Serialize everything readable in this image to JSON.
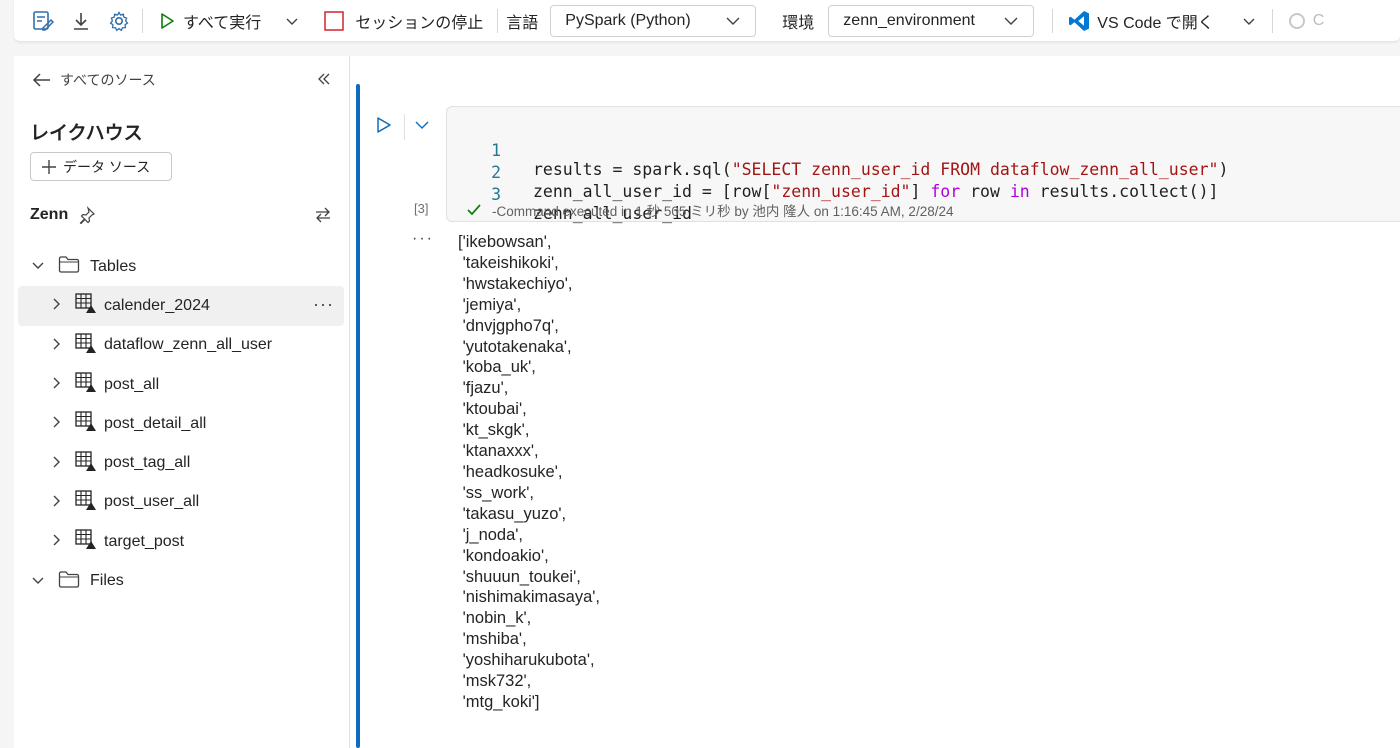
{
  "toolbar": {
    "run_all": "すべて実行",
    "stop_session": "セッションの停止",
    "language_label": "言語",
    "language_value": "PySpark (Python)",
    "env_label": "環境",
    "env_value": "zenn_environment",
    "open_vscode": "VS Code で開く",
    "trailing_text": "C"
  },
  "sidebar": {
    "back_label": "すべてのソース",
    "lakehouse_title": "レイクハウス",
    "add_source": "データ ソース",
    "lakehouse_name": "Zenn",
    "tables_folder": "Tables",
    "files_folder": "Files",
    "tables": [
      "calender_2024",
      "dataflow_zenn_all_user",
      "post_all",
      "post_detail_all",
      "post_tag_all",
      "post_user_all",
      "target_post"
    ]
  },
  "cell": {
    "line_numbers": [
      "1",
      "2",
      "3"
    ],
    "code": {
      "l1_a": "results = spark.sql(",
      "l1_str": "\"SELECT zenn_user_id FROM dataflow_zenn_all_user\"",
      "l1_b": ")",
      "l2_a": "zenn_all_user_id = [row[",
      "l2_str": "\"zenn_user_id\"",
      "l2_b": "] ",
      "l2_kw1": "for",
      "l2_c": " row ",
      "l2_kw2": "in",
      "l2_d": " results.collect()]",
      "l3": "zenn_all_user_id"
    },
    "exec_count": "[3]",
    "status": "-Command executed in 1 秒 505 ミリ秒 by 池内 隆人 on 1:16:45 AM, 2/28/24"
  },
  "output": {
    "dots": "···",
    "lines": [
      "['ikebowsan',",
      " 'takeishikoki',",
      " 'hwstakechiyo',",
      " 'jemiya',",
      " 'dnvjgpho7q',",
      " 'yutotakenaka',",
      " 'koba_uk',",
      " 'fjazu',",
      " 'ktoubai',",
      " 'kt_skgk',",
      " 'ktanaxxx',",
      " 'headkosuke',",
      " 'ss_work',",
      " 'takasu_yuzo',",
      " 'j_noda',",
      " 'kondoakio',",
      " 'shuuun_toukei',",
      " 'nishimakimasaya',",
      " 'nobin_k',",
      " 'mshiba',",
      " 'yoshiharukubota',",
      " 'msk732',",
      " 'mtg_koki']"
    ]
  },
  "colors": {
    "accent": "#0f6cbd",
    "run_green": "#107c10",
    "stop_red": "#d13438",
    "vscode_blue": "#0078d4"
  }
}
